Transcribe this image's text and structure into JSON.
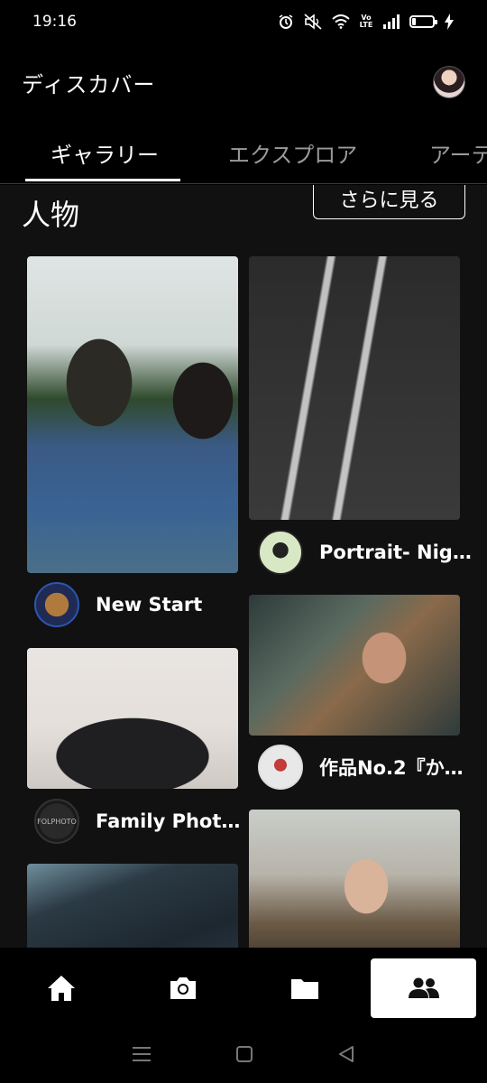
{
  "status_bar": {
    "time": "19:16",
    "icons": [
      "alarm-icon",
      "mute-icon",
      "wifi-icon",
      "volte-icon",
      "signal-icon",
      "battery-icon",
      "charging-icon"
    ],
    "volte_text": "Vo LTE",
    "battery_level": 0.15
  },
  "header": {
    "title": "ディスカバー"
  },
  "tabs": [
    {
      "label": "ギャラリー",
      "active": true
    },
    {
      "label": "エクスプロア",
      "active": false
    },
    {
      "label": "アーテ",
      "active": false
    }
  ],
  "section": {
    "title": "人物",
    "more_label": "さらに見る"
  },
  "cards": [
    {
      "title": "New Start"
    },
    {
      "title": "Portrait- Night"
    },
    {
      "title": "Family Photo…"
    },
    {
      "title": "作品No.2『か…"
    },
    {
      "title": ""
    },
    {
      "title": ""
    }
  ],
  "family_avatar_text": "FOLPHOTO",
  "bottom_nav": [
    {
      "icon": "home-icon",
      "active": false
    },
    {
      "icon": "camera-icon",
      "active": false
    },
    {
      "icon": "folder-icon",
      "active": false
    },
    {
      "icon": "community-icon",
      "active": true
    }
  ],
  "system_nav": [
    "menu-icon",
    "home-square-icon",
    "back-icon"
  ]
}
